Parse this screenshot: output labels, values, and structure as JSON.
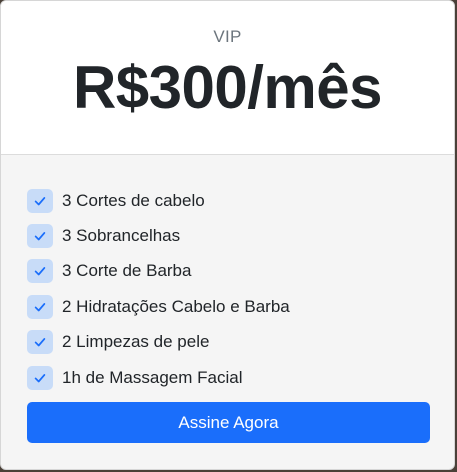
{
  "plan": {
    "name": "VIP",
    "price": "R$300/mês"
  },
  "features": [
    {
      "label": "3 Cortes de cabelo"
    },
    {
      "label": "3 Sobrancelhas"
    },
    {
      "label": "3 Corte de Barba"
    },
    {
      "label": "2 Hidratações Cabelo e Barba"
    },
    {
      "label": "2 Limpezas de pele"
    },
    {
      "label": "1h de Massagem Facial"
    }
  ],
  "cta": {
    "label": "Assine Agora"
  },
  "colors": {
    "accent": "#1a6efb",
    "check_bg": "#c8dcf8",
    "check_mark": "#1a6efb",
    "header_bg": "#ffffff",
    "body_bg": "#f5f5f5"
  }
}
